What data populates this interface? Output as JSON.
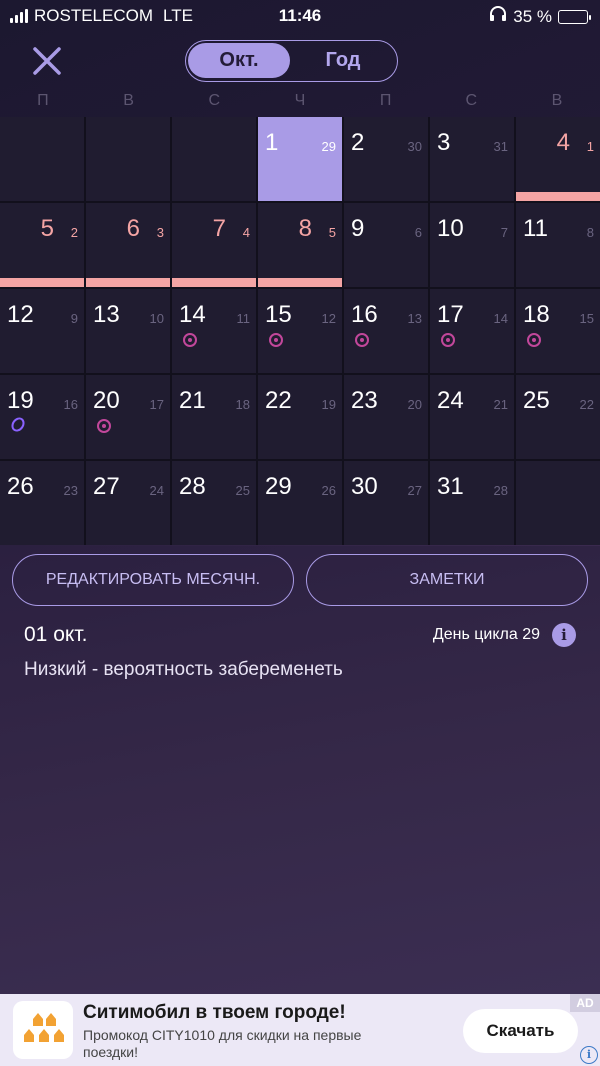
{
  "status_bar": {
    "carrier": "ROSTELECOM",
    "network": "LTE",
    "time": "11:46",
    "battery": "35 %"
  },
  "header": {
    "close_icon": "close-x-icon",
    "segments": [
      "Окт.",
      "Год"
    ]
  },
  "weekdays": [
    "П",
    "В",
    "С",
    "Ч",
    "П",
    "С",
    "В"
  ],
  "calendar": {
    "leading_empty": 3,
    "days": [
      {
        "date": "1",
        "cycle": "29",
        "selected": true
      },
      {
        "date": "2",
        "cycle": "30"
      },
      {
        "date": "3",
        "cycle": "31"
      },
      {
        "date": "4",
        "cycle": "1",
        "period": true
      },
      {
        "date": "5",
        "cycle": "2",
        "period": true
      },
      {
        "date": "6",
        "cycle": "3",
        "period": true
      },
      {
        "date": "7",
        "cycle": "4",
        "period": true
      },
      {
        "date": "8",
        "cycle": "5",
        "period": true
      },
      {
        "date": "9",
        "cycle": "6"
      },
      {
        "date": "10",
        "cycle": "7"
      },
      {
        "date": "11",
        "cycle": "8"
      },
      {
        "date": "12",
        "cycle": "9"
      },
      {
        "date": "13",
        "cycle": "10"
      },
      {
        "date": "14",
        "cycle": "11",
        "marker": "fertile"
      },
      {
        "date": "15",
        "cycle": "12",
        "marker": "fertile"
      },
      {
        "date": "16",
        "cycle": "13",
        "marker": "fertile"
      },
      {
        "date": "17",
        "cycle": "14",
        "marker": "fertile"
      },
      {
        "date": "18",
        "cycle": "15",
        "marker": "fertile"
      },
      {
        "date": "19",
        "cycle": "16",
        "marker": "ovulation"
      },
      {
        "date": "20",
        "cycle": "17",
        "marker": "fertile"
      },
      {
        "date": "21",
        "cycle": "18"
      },
      {
        "date": "22",
        "cycle": "19"
      },
      {
        "date": "23",
        "cycle": "20"
      },
      {
        "date": "24",
        "cycle": "21"
      },
      {
        "date": "25",
        "cycle": "22"
      },
      {
        "date": "26",
        "cycle": "23"
      },
      {
        "date": "27",
        "cycle": "24"
      },
      {
        "date": "28",
        "cycle": "25"
      },
      {
        "date": "29",
        "cycle": "26"
      },
      {
        "date": "30",
        "cycle": "27"
      },
      {
        "date": "31",
        "cycle": "28"
      }
    ],
    "trailing_empty": 1
  },
  "actions": {
    "edit_label": "РЕДАКТИРОВАТЬ МЕСЯЧН.",
    "notes_label": "ЗАМЕТКИ"
  },
  "details": {
    "date": "01 окт.",
    "cycle_day": "День цикла 29",
    "chance": "Низкий - вероятность забеременеть"
  },
  "ad": {
    "title": "Ситимобил в твоем городе!",
    "subtitle": "Промокод CITY1010 для скидки на первые поездки!",
    "button": "Скачать",
    "tag": "AD"
  },
  "colors": {
    "accent": "#a99be6",
    "period": "#f4a4a4",
    "fertile": "#c2479b",
    "ovulation": "#8a62ff"
  }
}
